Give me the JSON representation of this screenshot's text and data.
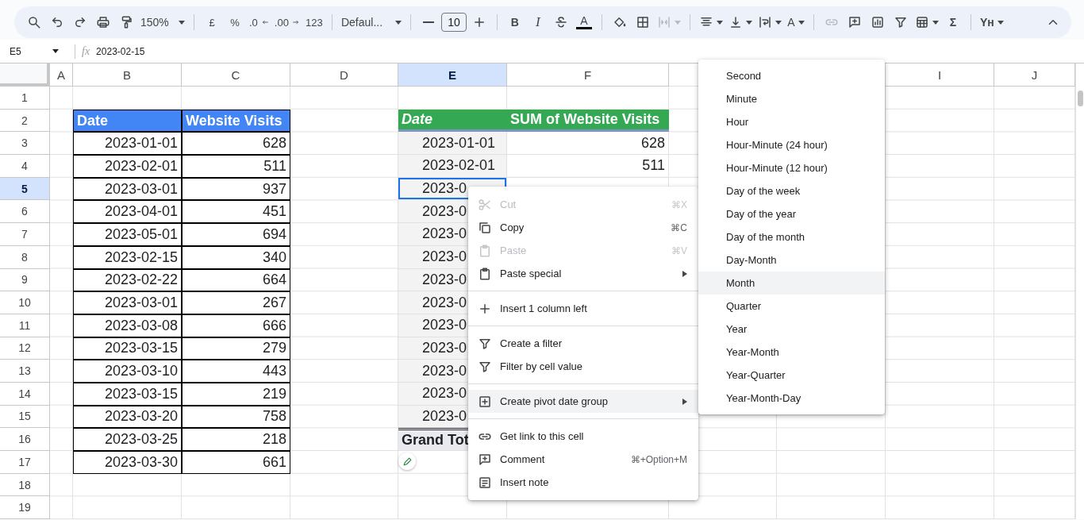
{
  "toolbar": {
    "zoom": "150%",
    "currency": "£",
    "percent": "%",
    "decrease_decimals": ".0",
    "increase_decimals": ".00",
    "more_formats": "123",
    "font": "Defaul...",
    "font_size": "10",
    "bold": "B",
    "italic": "I",
    "text_color": "A",
    "text_rotation": "A",
    "sum": "Σ",
    "addon": "Yн",
    "merge": {
      "disabled": true
    },
    "link": {
      "disabled": true
    }
  },
  "formula_bar": {
    "cell_ref": "E5",
    "fx": "fx",
    "value": "2023-02-15"
  },
  "columns": [
    {
      "label": "A",
      "selected": false
    },
    {
      "label": "B",
      "selected": false
    },
    {
      "label": "C",
      "selected": false
    },
    {
      "label": "D",
      "selected": false
    },
    {
      "label": "E",
      "selected": true
    },
    {
      "label": "F",
      "selected": false
    },
    {
      "label": "I",
      "selected": false
    },
    {
      "label": "J",
      "selected": false
    }
  ],
  "row_numbers": [
    {
      "label": "1",
      "selected": false
    },
    {
      "label": "2",
      "selected": false
    },
    {
      "label": "3",
      "selected": false
    },
    {
      "label": "4",
      "selected": false
    },
    {
      "label": "5",
      "selected": true
    },
    {
      "label": "6",
      "selected": false
    },
    {
      "label": "7",
      "selected": false
    },
    {
      "label": "8",
      "selected": false
    },
    {
      "label": "9",
      "selected": false
    },
    {
      "label": "10",
      "selected": false
    },
    {
      "label": "11",
      "selected": false
    },
    {
      "label": "12",
      "selected": false
    },
    {
      "label": "13",
      "selected": false
    },
    {
      "label": "14",
      "selected": false
    },
    {
      "label": "15",
      "selected": false
    },
    {
      "label": "16",
      "selected": false
    },
    {
      "label": "17",
      "selected": false
    },
    {
      "label": "18",
      "selected": false
    },
    {
      "label": "19",
      "selected": false
    }
  ],
  "source_table": {
    "columns": [
      "Date",
      "Website Visits"
    ],
    "rows": [
      [
        "2023-01-01",
        "628"
      ],
      [
        "2023-02-01",
        "511"
      ],
      [
        "2023-03-01",
        "937"
      ],
      [
        "2023-04-01",
        "451"
      ],
      [
        "2023-05-01",
        "694"
      ],
      [
        "2023-02-15",
        "340"
      ],
      [
        "2023-02-22",
        "664"
      ],
      [
        "2023-03-01",
        "267"
      ],
      [
        "2023-03-08",
        "666"
      ],
      [
        "2023-03-15",
        "279"
      ],
      [
        "2023-03-10",
        "443"
      ],
      [
        "2023-03-15",
        "219"
      ],
      [
        "2023-03-20",
        "758"
      ],
      [
        "2023-03-25",
        "218"
      ],
      [
        "2023-03-30",
        "661"
      ]
    ]
  },
  "pivot_table": {
    "columns": [
      "Date",
      "SUM of Website Visits"
    ],
    "rows": [
      {
        "date": "2023-01-01",
        "visits": "628",
        "selected": false
      },
      {
        "date": "2023-02-01",
        "visits": "511",
        "selected": false
      },
      {
        "date": "2023-0",
        "selected": true
      },
      {
        "date": "2023-0",
        "selected": false
      },
      {
        "date": "2023-0",
        "selected": false
      },
      {
        "date": "2023-0",
        "selected": false
      },
      {
        "date": "2023-0",
        "selected": false
      },
      {
        "date": "2023-0",
        "selected": false
      },
      {
        "date": "2023-0",
        "selected": false
      },
      {
        "date": "2023-0",
        "selected": false
      },
      {
        "date": "2023-0",
        "selected": false
      },
      {
        "date": "2023-0",
        "selected": false
      },
      {
        "date": "2023-0",
        "selected": false
      }
    ],
    "total_label": "Grand Tot"
  },
  "context_menu": [
    {
      "kind": "item",
      "label": "Cut",
      "shortcut": "⌘X",
      "disabled": true,
      "selected": false,
      "submenu": false
    },
    {
      "kind": "item",
      "label": "Copy",
      "shortcut": "⌘C",
      "disabled": false,
      "selected": false,
      "submenu": false
    },
    {
      "kind": "item",
      "label": "Paste",
      "shortcut": "⌘V",
      "disabled": true,
      "selected": false,
      "submenu": false
    },
    {
      "kind": "item",
      "label": "Paste special",
      "disabled": false,
      "selected": false,
      "submenu": true
    },
    {
      "kind": "separator"
    },
    {
      "kind": "item",
      "label": "Insert 1 column left",
      "disabled": false,
      "selected": false,
      "submenu": false
    },
    {
      "kind": "separator"
    },
    {
      "kind": "item",
      "label": "Create a filter",
      "disabled": false,
      "selected": false,
      "submenu": false
    },
    {
      "kind": "item",
      "label": "Filter by cell value",
      "disabled": false,
      "selected": false,
      "submenu": false
    },
    {
      "kind": "separator"
    },
    {
      "kind": "item",
      "label": "Create pivot date group",
      "disabled": false,
      "selected": true,
      "submenu": true
    },
    {
      "kind": "separator"
    },
    {
      "kind": "item",
      "label": "Get link to this cell",
      "disabled": false,
      "selected": false,
      "submenu": false
    },
    {
      "kind": "item",
      "label": "Comment",
      "shortcut": "⌘+Option+M",
      "disabled": false,
      "selected": false,
      "submenu": false
    },
    {
      "kind": "item",
      "label": "Insert note",
      "disabled": false,
      "selected": false,
      "submenu": false
    }
  ],
  "date_group_menu": [
    {
      "label": "Second",
      "selected": false
    },
    {
      "label": "Minute",
      "selected": false
    },
    {
      "label": "Hour",
      "selected": false
    },
    {
      "label": "Hour-Minute (24 hour)",
      "selected": false
    },
    {
      "label": "Hour-Minute (12 hour)",
      "selected": false
    },
    {
      "label": "Day of the week",
      "selected": false
    },
    {
      "label": "Day of the year",
      "selected": false
    },
    {
      "label": "Day of the month",
      "selected": false
    },
    {
      "label": "Day-Month",
      "selected": false
    },
    {
      "label": "Month",
      "selected": true
    },
    {
      "label": "Quarter",
      "selected": false
    },
    {
      "label": "Year",
      "selected": false
    },
    {
      "label": "Year-Month",
      "selected": false
    },
    {
      "label": "Year-Quarter",
      "selected": false
    },
    {
      "label": "Year-Month-Day",
      "selected": false
    }
  ]
}
